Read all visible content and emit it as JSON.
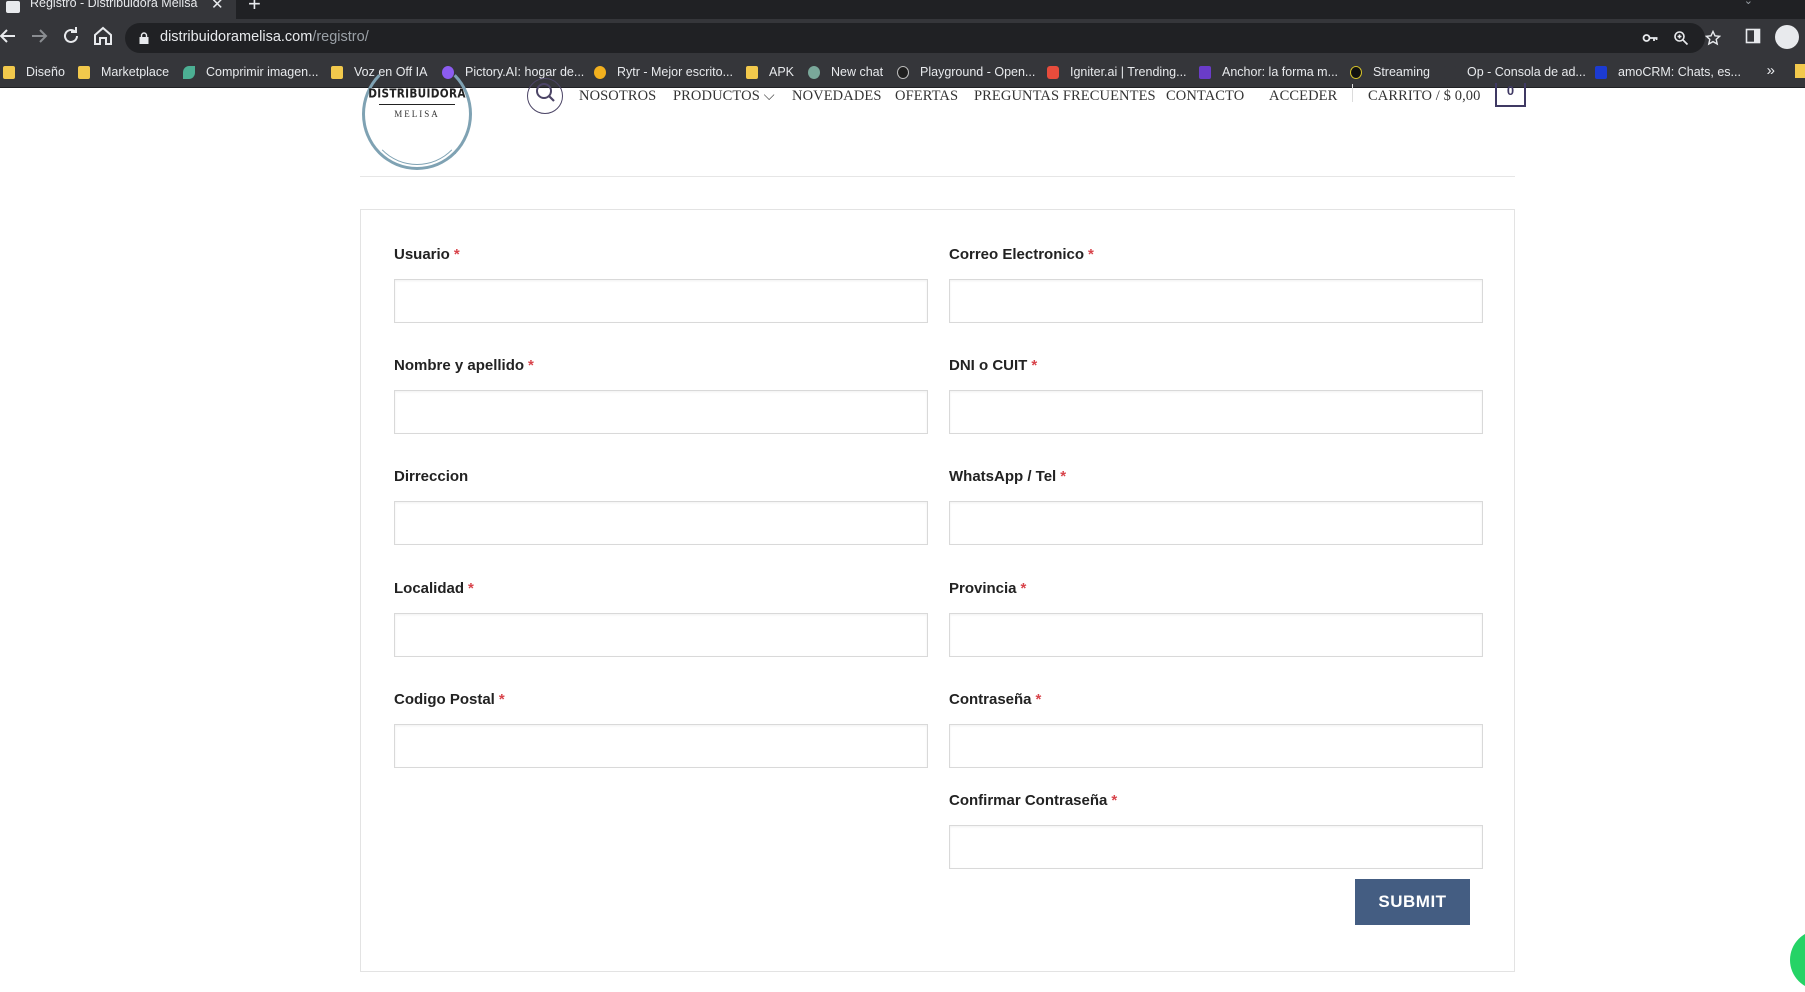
{
  "browser": {
    "tab_title": "Registro - Distribuidora Melisa",
    "close_glyph": "✕",
    "new_tab_glyph": "+",
    "url_host": "distribuidoramelisa.com",
    "url_path": "/registro/",
    "bookmarks": [
      {
        "label": "Diseño",
        "icon": "folder-icon",
        "color": "#f2c94c"
      },
      {
        "label": "Marketplace",
        "icon": "folder-icon",
        "color": "#f2c94c"
      },
      {
        "label": "Comprimir imagen...",
        "icon": "leaf-icon",
        "color": "#4caf93"
      },
      {
        "label": "Voz en Off IA",
        "icon": "folder-icon",
        "color": "#f2c94c"
      },
      {
        "label": "Pictory.AI: hogar de...",
        "icon": "pictory-icon",
        "color": "#8c5cf0"
      },
      {
        "label": "Rytr - Mejor escrito...",
        "icon": "rytr-icon",
        "color": "#f2b01e"
      },
      {
        "label": "APK",
        "icon": "folder-icon",
        "color": "#f2c94c"
      },
      {
        "label": "New chat",
        "icon": "chatgpt-icon",
        "color": "#7aa89a"
      },
      {
        "label": "Playground - Open...",
        "icon": "openai-icon",
        "color": "#1f1f1f"
      },
      {
        "label": "Igniter.ai | Trending...",
        "icon": "igniter-icon",
        "color": "#e74c3c"
      },
      {
        "label": "Anchor: la forma m...",
        "icon": "anchor-icon",
        "color": "#6a3cc9"
      },
      {
        "label": "Streaming",
        "icon": "streaming-icon",
        "color": "#111111"
      },
      {
        "label": "Op - Consola de ad...",
        "icon": "op-icon",
        "color": "#35363a"
      },
      {
        "label": "amoCRM: Chats, es...",
        "icon": "amocrm-icon",
        "color": "#1c3bd1"
      }
    ],
    "more_bookmarks_glyph": "»"
  },
  "site": {
    "logo_name": "DISTRIBUIDORA",
    "logo_sub": "MELISA",
    "nav": [
      {
        "label": "NOSOTROS"
      },
      {
        "label": "PRODUCTOS ⌵"
      },
      {
        "label": "NOVEDADES"
      },
      {
        "label": "OFERTAS"
      },
      {
        "label": "PREGUNTAS FRECUENTES"
      },
      {
        "label": "CONTACTO"
      },
      {
        "label": "ACCEDER"
      }
    ],
    "cart_label": "CARRITO / $ 0,00",
    "cart_count": "0"
  },
  "form": {
    "fields": [
      {
        "label": "Usuario",
        "required_mark": "*",
        "value": ""
      },
      {
        "label": "Correo Electronico",
        "required_mark": "*",
        "value": ""
      },
      {
        "label": "Nombre y apellido",
        "required_mark": "*",
        "value": ""
      },
      {
        "label": "DNI o CUIT",
        "required_mark": "*",
        "value": ""
      },
      {
        "label": "Dirreccion",
        "required_mark": "",
        "value": ""
      },
      {
        "label": "WhatsApp / Tel",
        "required_mark": "*",
        "value": ""
      },
      {
        "label": "Localidad",
        "required_mark": "*",
        "value": ""
      },
      {
        "label": "Provincia",
        "required_mark": "*",
        "value": ""
      },
      {
        "label": "Codigo Postal",
        "required_mark": "*",
        "value": ""
      },
      {
        "label": "Contraseña",
        "required_mark": "*",
        "value": ""
      },
      {
        "label": "Confirmar Contraseña",
        "required_mark": "*",
        "value": ""
      }
    ],
    "submit_label": "SUBMIT"
  },
  "colors": {
    "accent": "#445d82",
    "required": "#d8444b",
    "brand_ring": "#7fa2b3"
  }
}
